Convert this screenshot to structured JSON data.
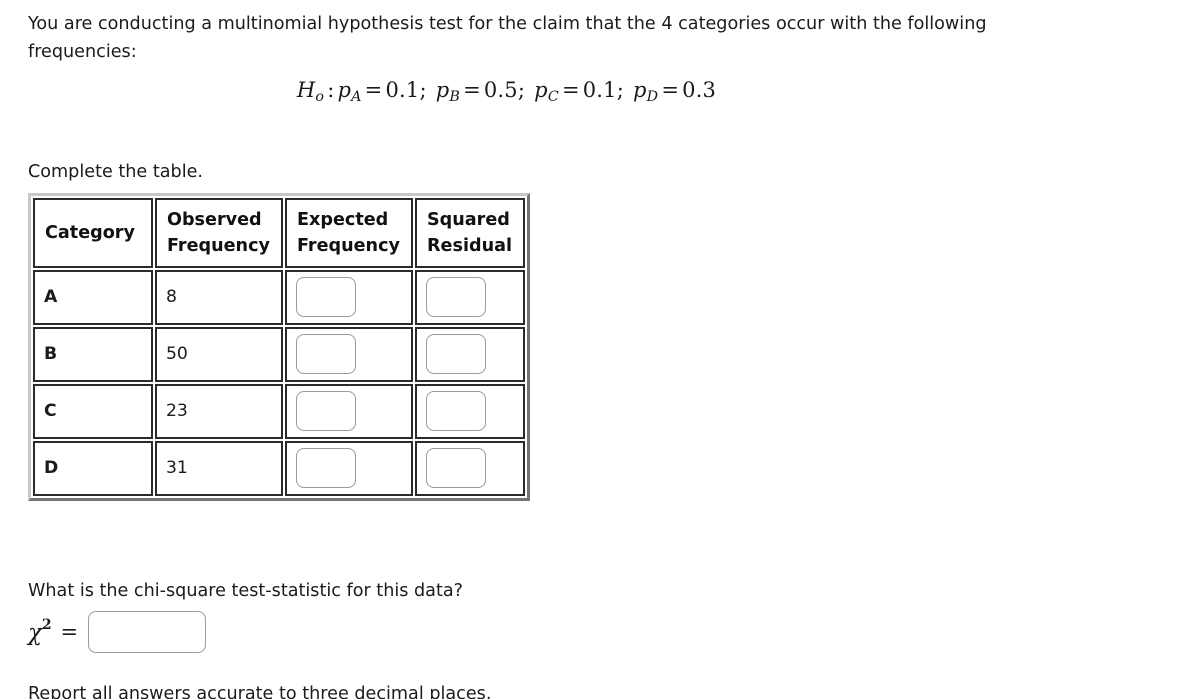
{
  "problem": {
    "intro": "You are conducting a multinomial hypothesis test for the claim that the 4 categories occur with the following frequencies:",
    "hypothesis": {
      "symbol": "H",
      "subscript": "o",
      "colon": ":",
      "terms": [
        {
          "var": "p",
          "sub": "A",
          "eq": "=",
          "value": "0.1",
          "sep": ";"
        },
        {
          "var": "p",
          "sub": "B",
          "eq": "=",
          "value": "0.5",
          "sep": ";"
        },
        {
          "var": "p",
          "sub": "C",
          "eq": "=",
          "value": "0.1",
          "sep": ";"
        },
        {
          "var": "p",
          "sub": "D",
          "eq": "=",
          "value": "0.3",
          "sep": ""
        }
      ],
      "plain_text": "Hₒ : pₐ = 0.1; p_B = 0.5; p_C = 0.1; p_D = 0.3"
    },
    "complete_table_label": "Complete the table.",
    "question": "What is the chi-square test-statistic for this data?",
    "footnote": "Report all answers accurate to three decimal places."
  },
  "table": {
    "headers": [
      {
        "line1": "Category",
        "line2": ""
      },
      {
        "line1": "Observed",
        "line2": "Frequency"
      },
      {
        "line1": "Expected",
        "line2": "Frequency"
      },
      {
        "line1": "Squared",
        "line2": "Residual"
      }
    ],
    "rows": [
      {
        "category": "A",
        "observed": "8",
        "expected": "",
        "squared_residual": ""
      },
      {
        "category": "B",
        "observed": "50",
        "expected": "",
        "squared_residual": ""
      },
      {
        "category": "C",
        "observed": "23",
        "expected": "",
        "squared_residual": ""
      },
      {
        "category": "D",
        "observed": "31",
        "expected": "",
        "squared_residual": ""
      }
    ]
  },
  "chi_square": {
    "symbol": "χ",
    "exponent": "2",
    "equals": "=",
    "value": "",
    "placeholder": ""
  },
  "colors": {
    "text": "#1b1b1b",
    "page_background": "#ffffff",
    "cell_border": "#2b2b2b",
    "table_outer_border": "#c8c8c8",
    "input_border": "#9a9a9a"
  }
}
